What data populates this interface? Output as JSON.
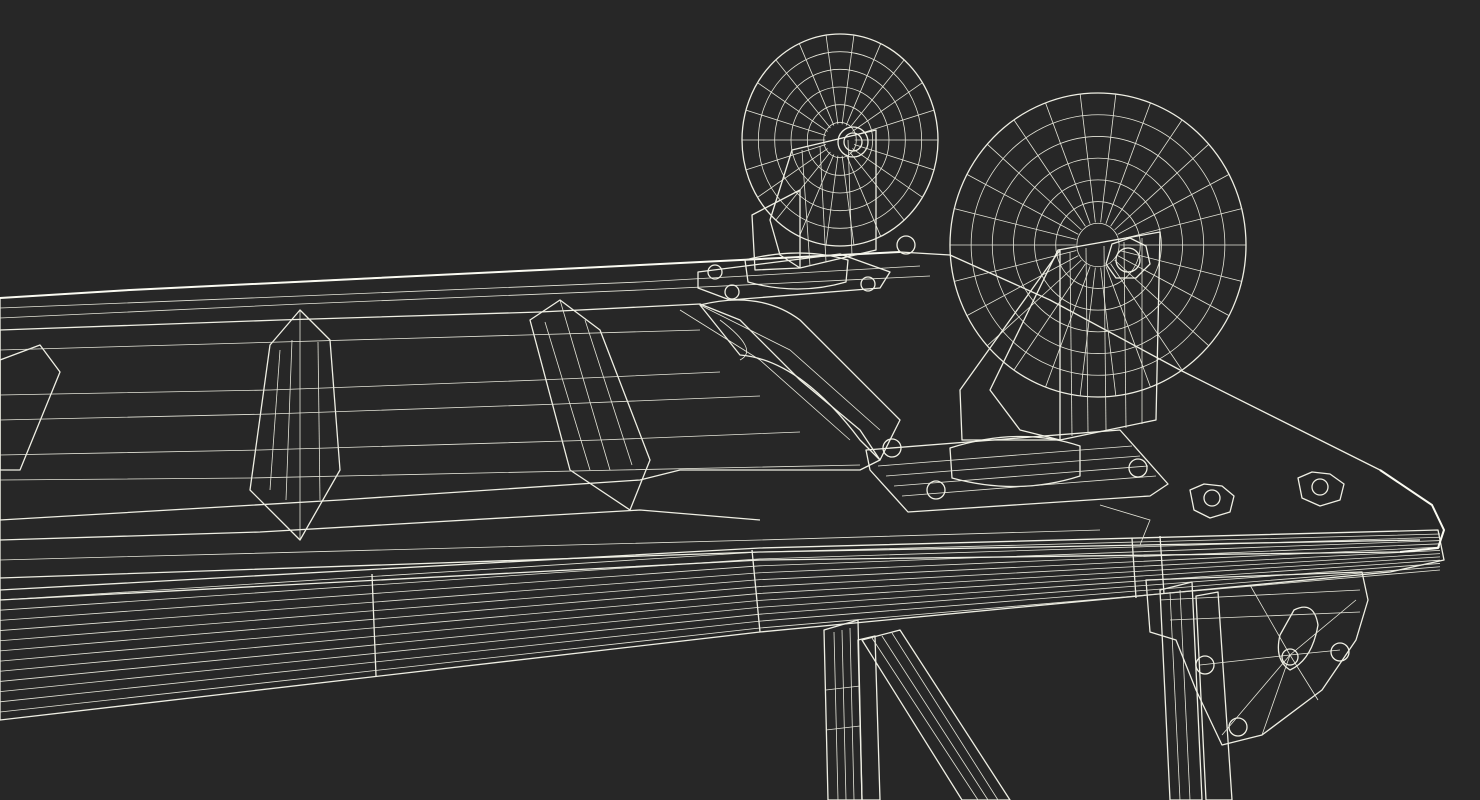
{
  "scene": {
    "background_color": "#272727",
    "surface_color": "#74746a",
    "surface_shadow_color": "#5d5d55",
    "wire_color": "#efefe4",
    "subject": "wireframe-render-conveyor-frame-with-caster-wheels"
  }
}
